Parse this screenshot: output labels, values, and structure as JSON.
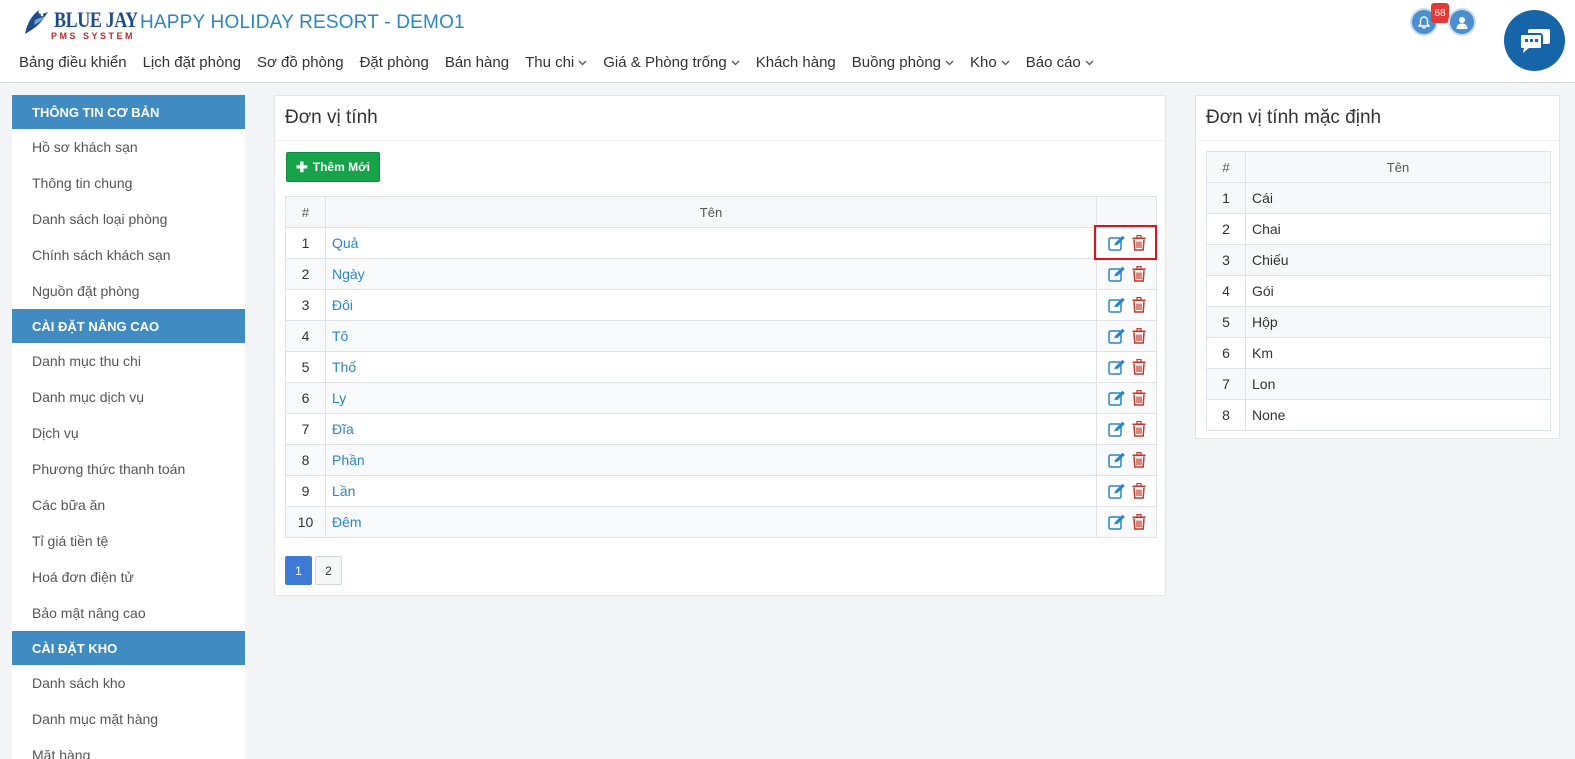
{
  "header": {
    "logo_text": "BLUE JAY",
    "logo_sub": "PMS SYSTEM",
    "hotel_title": "HAPPY HOLIDAY RESORT - DEMO1",
    "notification_count": "68",
    "accent_color": "#2d86c4"
  },
  "nav": [
    {
      "label": "Bảng điều khiển",
      "dropdown": false
    },
    {
      "label": "Lịch đặt phòng",
      "dropdown": false
    },
    {
      "label": "Sơ đồ phòng",
      "dropdown": false
    },
    {
      "label": "Đặt phòng",
      "dropdown": false
    },
    {
      "label": "Bán hàng",
      "dropdown": false
    },
    {
      "label": "Thu chi",
      "dropdown": true
    },
    {
      "label": "Giá & Phòng trống",
      "dropdown": true
    },
    {
      "label": "Khách hàng",
      "dropdown": false
    },
    {
      "label": "Buồng phòng",
      "dropdown": true
    },
    {
      "label": "Kho",
      "dropdown": true
    },
    {
      "label": "Báo cáo",
      "dropdown": true
    }
  ],
  "sidebar": {
    "sections": [
      {
        "title": "THÔNG TIN CƠ BẢN",
        "items": [
          "Hồ sơ khách sạn",
          "Thông tin chung",
          "Danh sách loại phòng",
          "Chính sách khách sạn",
          "Nguồn đặt phòng"
        ]
      },
      {
        "title": "CÀI ĐẶT NÂNG CAO",
        "items": [
          "Danh mục thu chi",
          "Danh mục dịch vụ",
          "Dịch vụ",
          "Phương thức thanh toán",
          "Các bữa ăn",
          "Tỉ giá tiền tệ",
          "Hoá đơn điện tử",
          "Bảo mật nâng cao"
        ]
      },
      {
        "title": "CÀI ĐẶT KHO",
        "items": [
          "Danh sách kho",
          "Danh mục mặt hàng",
          "Mặt hàng"
        ]
      }
    ]
  },
  "main": {
    "title": "Đơn vị tính",
    "add_button": "Thêm Mới",
    "table": {
      "headers": [
        "#",
        "Tên",
        ""
      ],
      "rows": [
        {
          "num": "1",
          "name": "Quả"
        },
        {
          "num": "2",
          "name": "Ngày"
        },
        {
          "num": "3",
          "name": "Đôi"
        },
        {
          "num": "4",
          "name": "Tô"
        },
        {
          "num": "5",
          "name": "Thố"
        },
        {
          "num": "6",
          "name": "Ly"
        },
        {
          "num": "7",
          "name": "Đĩa"
        },
        {
          "num": "8",
          "name": "Phần"
        },
        {
          "num": "9",
          "name": "Lần"
        },
        {
          "num": "10",
          "name": "Đêm"
        }
      ]
    },
    "pagination": {
      "pages": [
        "1",
        "2"
      ],
      "current": "1"
    }
  },
  "default_units": {
    "title": "Đơn vị tính mặc định",
    "headers": [
      "#",
      "Tên"
    ],
    "rows": [
      {
        "num": "1",
        "name": "Cái"
      },
      {
        "num": "2",
        "name": "Chai"
      },
      {
        "num": "3",
        "name": "Chiếu"
      },
      {
        "num": "4",
        "name": "Gói"
      },
      {
        "num": "5",
        "name": "Hộp"
      },
      {
        "num": "6",
        "name": "Km"
      },
      {
        "num": "7",
        "name": "Lon"
      },
      {
        "num": "8",
        "name": "None"
      }
    ]
  },
  "icons": {
    "edit": "edit-icon",
    "delete": "trash-icon",
    "bell": "bell-icon",
    "user": "user-icon",
    "chat": "chat-icon",
    "add": "plus-icon",
    "dropdown": "chevron-down-icon"
  }
}
